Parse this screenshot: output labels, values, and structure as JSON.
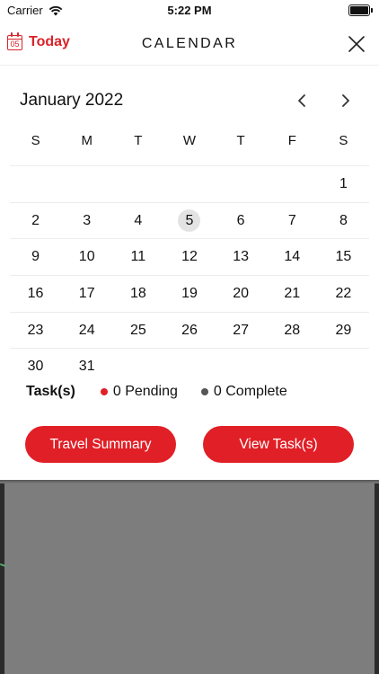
{
  "status_bar": {
    "carrier": "Carrier",
    "time": "5:22 PM"
  },
  "header": {
    "today_label": "Today",
    "today_icon_day": "05",
    "title": "CALENDAR",
    "accent_color": "#d9232a"
  },
  "calendar": {
    "month_label": "January 2022",
    "weekdays": [
      "S",
      "M",
      "T",
      "W",
      "T",
      "F",
      "S"
    ],
    "weeks": [
      [
        "",
        "",
        "",
        "",
        "",
        "",
        "1"
      ],
      [
        "2",
        "3",
        "4",
        "5",
        "6",
        "7",
        "8"
      ],
      [
        "9",
        "10",
        "11",
        "12",
        "13",
        "14",
        "15"
      ],
      [
        "16",
        "17",
        "18",
        "19",
        "20",
        "21",
        "22"
      ],
      [
        "23",
        "24",
        "25",
        "26",
        "27",
        "28",
        "29"
      ],
      [
        "30",
        "31",
        "",
        "",
        "",
        "",
        ""
      ]
    ],
    "today": "5"
  },
  "tasks": {
    "label": "Task(s)",
    "pending": "0 Pending",
    "pending_color": "#e11f26",
    "complete": "0 Complete",
    "complete_color": "#555555"
  },
  "actions": {
    "travel_summary": "Travel Summary",
    "view_tasks": "View Task(s)",
    "button_color": "#e11f26"
  }
}
